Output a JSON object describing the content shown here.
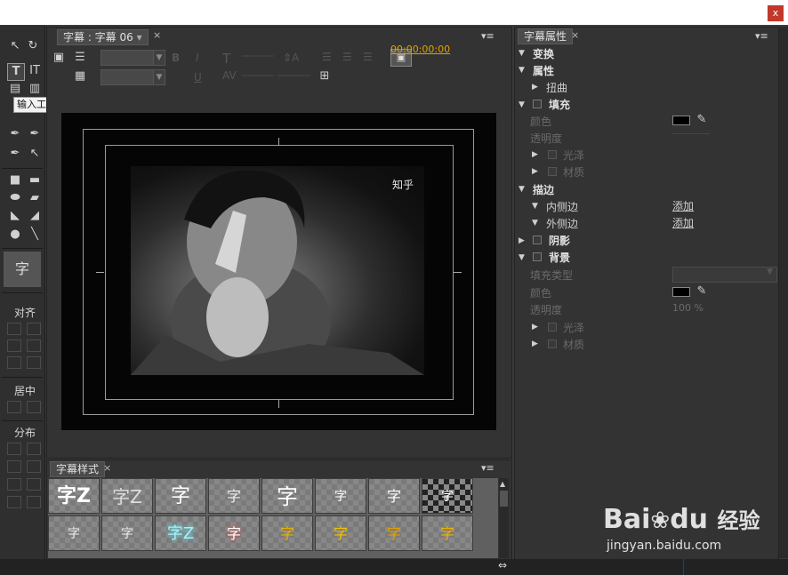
{
  "window": {
    "close_label": "x"
  },
  "tools": {
    "tooltip": "输入工具 (T)",
    "sections": {
      "align": "对齐",
      "center": "居中",
      "distribute": "分布"
    },
    "preview_glyph": "字"
  },
  "title_panel": {
    "tab_label": "字幕 : 字幕 06",
    "tab_close": "×",
    "menu_icon": "▾≡",
    "timecode": "00:00:00:00"
  },
  "canvas": {
    "watermark_text": "知乎"
  },
  "styles_panel": {
    "tab_label": "字幕样式",
    "tab_close": "×",
    "menu_icon": "▾≡",
    "row1": [
      "字Z",
      "字Z",
      "字",
      "字",
      "字",
      "字",
      "字",
      "字"
    ],
    "row2": [
      "字",
      "字",
      "字Z",
      "字",
      "字",
      "字",
      "字",
      "字"
    ]
  },
  "properties": {
    "tab_label": "字幕属性",
    "tab_close": "×",
    "menu_icon": "▾≡",
    "transform": "变换",
    "attributes": "属性",
    "distort": "扭曲",
    "fill": "填充",
    "fill_color": "颜色",
    "fill_opacity": "透明度",
    "sheen": "光泽",
    "texture": "材质",
    "stroke": "描边",
    "inner_stroke": "内侧边",
    "outer_stroke": "外侧边",
    "add": "添加",
    "shadow": "阴影",
    "background": "背景",
    "fill_type": "填充类型",
    "bg_color": "颜色",
    "bg_opacity": "透明度",
    "bg_opacity_value": "100 %",
    "bg_sheen": "光泽",
    "bg_texture": "材质"
  },
  "watermark_logo": {
    "brand": "Bai",
    "brand2": "du",
    "suffix": "经验",
    "url": "jingyan.baidu.com"
  }
}
